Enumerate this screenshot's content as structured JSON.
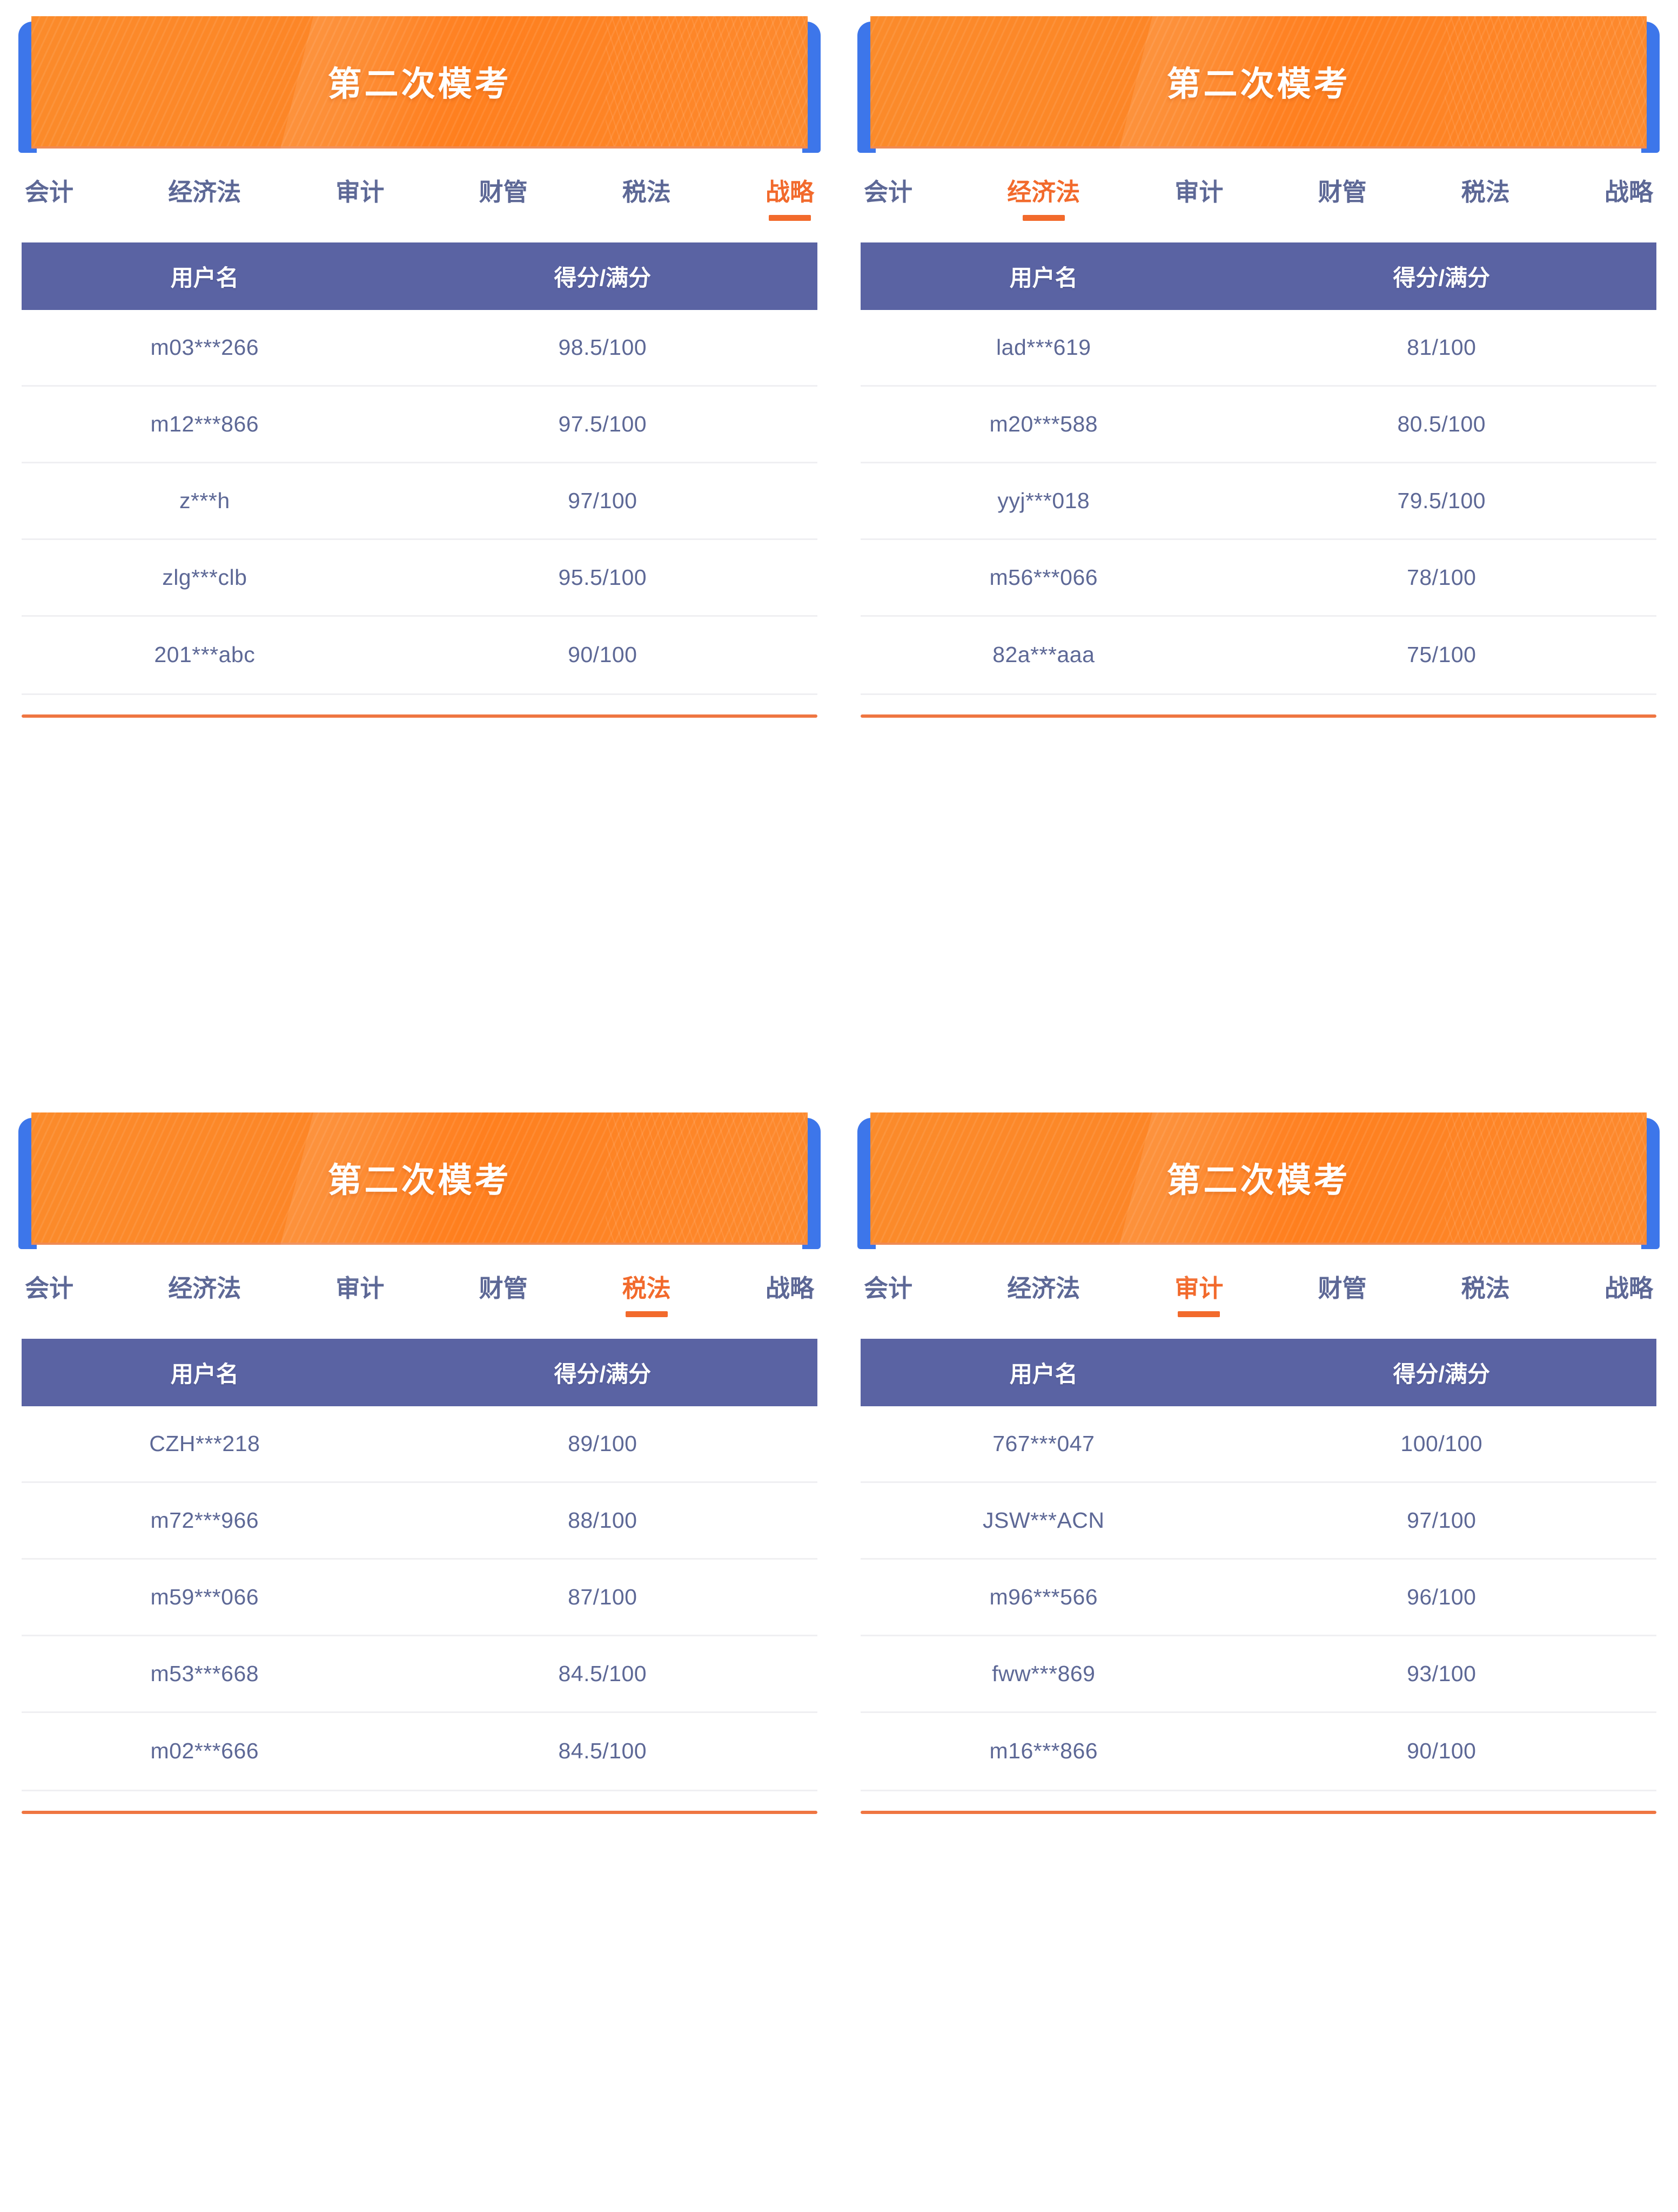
{
  "colors": {
    "banner_orange": "#fd8526",
    "banner_blue": "#3d76ea",
    "tab_inactive": "#5d6896",
    "tab_active": "#f26a2c",
    "table_header_purple": "#5a63a3",
    "row_text": "#5d6896",
    "divider_orange": "#ef7642",
    "divider_grey": "#efeff2"
  },
  "table_columns": {
    "username": "用户名",
    "score": "得分/满分"
  },
  "panels": [
    {
      "banner_title": "第二次模考",
      "tabs": [
        {
          "label": "会计",
          "active": false
        },
        {
          "label": "经济法",
          "active": false
        },
        {
          "label": "审计",
          "active": false
        },
        {
          "label": "财管",
          "active": false
        },
        {
          "label": "税法",
          "active": false
        },
        {
          "label": "战略",
          "active": true
        }
      ],
      "rows": [
        {
          "username": "m03***266",
          "score": "98.5/100"
        },
        {
          "username": "m12***866",
          "score": "97.5/100"
        },
        {
          "username": "z***h",
          "score": "97/100"
        },
        {
          "username": "zlg***clb",
          "score": "95.5/100"
        },
        {
          "username": "201***abc",
          "score": "90/100"
        }
      ]
    },
    {
      "banner_title": "第二次模考",
      "tabs": [
        {
          "label": "会计",
          "active": false
        },
        {
          "label": "经济法",
          "active": true
        },
        {
          "label": "审计",
          "active": false
        },
        {
          "label": "财管",
          "active": false
        },
        {
          "label": "税法",
          "active": false
        },
        {
          "label": "战略",
          "active": false
        }
      ],
      "rows": [
        {
          "username": "lad***619",
          "score": "81/100"
        },
        {
          "username": "m20***588",
          "score": "80.5/100"
        },
        {
          "username": "yyj***018",
          "score": "79.5/100"
        },
        {
          "username": "m56***066",
          "score": "78/100"
        },
        {
          "username": "82a***aaa",
          "score": "75/100"
        }
      ]
    },
    {
      "banner_title": "第二次模考",
      "tabs": [
        {
          "label": "会计",
          "active": false
        },
        {
          "label": "经济法",
          "active": false
        },
        {
          "label": "审计",
          "active": false
        },
        {
          "label": "财管",
          "active": false
        },
        {
          "label": "税法",
          "active": true
        },
        {
          "label": "战略",
          "active": false
        }
      ],
      "rows": [
        {
          "username": "CZH***218",
          "score": "89/100"
        },
        {
          "username": "m72***966",
          "score": "88/100"
        },
        {
          "username": "m59***066",
          "score": "87/100"
        },
        {
          "username": "m53***668",
          "score": "84.5/100"
        },
        {
          "username": "m02***666",
          "score": "84.5/100"
        }
      ]
    },
    {
      "banner_title": "第二次模考",
      "tabs": [
        {
          "label": "会计",
          "active": false
        },
        {
          "label": "经济法",
          "active": false
        },
        {
          "label": "审计",
          "active": true
        },
        {
          "label": "财管",
          "active": false
        },
        {
          "label": "税法",
          "active": false
        },
        {
          "label": "战略",
          "active": false
        }
      ],
      "rows": [
        {
          "username": "767***047",
          "score": "100/100"
        },
        {
          "username": "JSW***ACN",
          "score": "97/100"
        },
        {
          "username": "m96***566",
          "score": "96/100"
        },
        {
          "username": "fww***869",
          "score": "93/100"
        },
        {
          "username": "m16***866",
          "score": "90/100"
        }
      ]
    }
  ]
}
